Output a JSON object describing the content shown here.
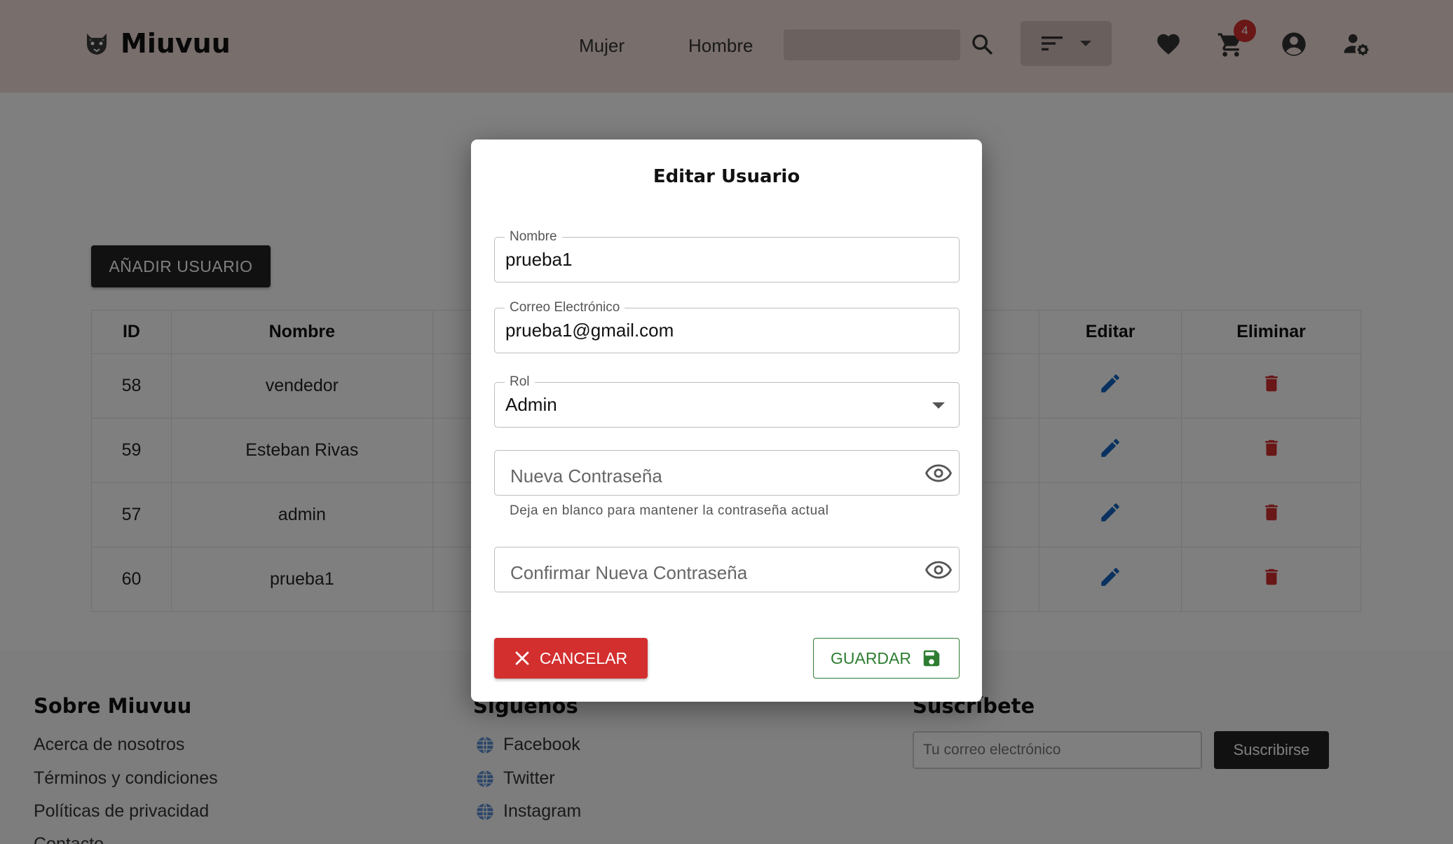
{
  "header": {
    "brand": "Miuvuu",
    "nav": [
      "Mujer",
      "Hombre"
    ],
    "cart_count": "4"
  },
  "main": {
    "add_user_label": "AÑADIR USUARIO",
    "table": {
      "headers": [
        "ID",
        "Nombre",
        "Editar",
        "Eliminar"
      ],
      "rows": [
        {
          "id": "58",
          "name": "vendedor"
        },
        {
          "id": "59",
          "name": "Esteban Rivas"
        },
        {
          "id": "57",
          "name": "admin"
        },
        {
          "id": "60",
          "name": "prueba1"
        }
      ]
    }
  },
  "footer": {
    "about": {
      "title": "Sobre Miuvuu",
      "links": [
        "Acerca de nosotros",
        "Términos y condiciones",
        "Políticas de privacidad",
        "Contacto"
      ]
    },
    "social": {
      "title": "Síguenos",
      "links": [
        "Facebook",
        "Twitter",
        "Instagram"
      ]
    },
    "subscribe": {
      "title": "Suscríbete",
      "placeholder": "Tu correo electrónico",
      "button": "Suscribirse"
    }
  },
  "modal": {
    "title": "Editar Usuario",
    "name_label": "Nombre",
    "name_value": "prueba1",
    "email_label": "Correo Electrónico",
    "email_value": "prueba1@gmail.com",
    "role_label": "Rol",
    "role_value": "Admin",
    "new_password_placeholder": "Nueva Contraseña",
    "new_password_helper": "Deja en blanco para mantener la contraseña actual",
    "confirm_password_placeholder": "Confirmar Nueva Contraseña",
    "cancel_label": "CANCELAR",
    "save_label": "GUARDAR"
  },
  "colors": {
    "header_bg": "#f0dcd7",
    "danger": "#d32f2f",
    "edit_blue": "#1565c0",
    "success": "#2e7d32"
  }
}
